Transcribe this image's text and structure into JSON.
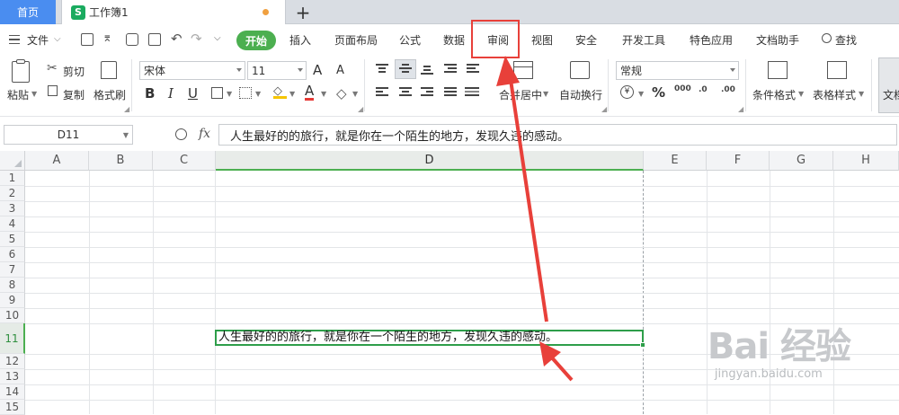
{
  "tabs": {
    "home": "首页",
    "doc_title": "工作簿1",
    "doc_icon": "S",
    "add": "+"
  },
  "menu": {
    "file": "文件",
    "start": "开始",
    "items": [
      "插入",
      "页面布局",
      "公式",
      "数据",
      "审阅",
      "视图",
      "安全",
      "开发工具",
      "特色应用",
      "文档助手",
      "查找"
    ]
  },
  "ribbon": {
    "paste": "粘贴",
    "cut": "剪切",
    "copy": "复制",
    "format_painter": "格式刷",
    "font_name": "宋体",
    "font_size": "11",
    "font_inc": "A",
    "font_dec": "A",
    "bold": "B",
    "italic": "I",
    "underline": "U",
    "merge_center": "合并居中",
    "auto_wrap": "自动换行",
    "number_format": "常规",
    "percent": "%",
    "thousand": "000",
    "dec_inc": ".0",
    "dec_dec": ".00",
    "conditional_format": "条件格式",
    "table_style": "表格样式",
    "doc_partial": "文档"
  },
  "formula_bar": {
    "name_box": "D11",
    "fx": "fx",
    "content": "人生最好的的旅行，就是你在一个陌生的地方，发现久违的感动。"
  },
  "sheet": {
    "columns": [
      "A",
      "B",
      "C",
      "D",
      "E",
      "F",
      "G",
      "H"
    ],
    "rows": [
      "1",
      "2",
      "3",
      "4",
      "5",
      "6",
      "7",
      "8",
      "9",
      "10",
      "11",
      "12",
      "13",
      "14",
      "15"
    ],
    "active_cell_text": "人生最好的的旅行，就是你在一个陌生的地方，发现久违的感动。"
  },
  "watermark": {
    "main": "Bai 经验",
    "sub": "jingyan.baidu.com"
  },
  "colors": {
    "accent_green": "#4caf50",
    "home_tab": "#4a8df0",
    "annotation": "#e8403a"
  }
}
